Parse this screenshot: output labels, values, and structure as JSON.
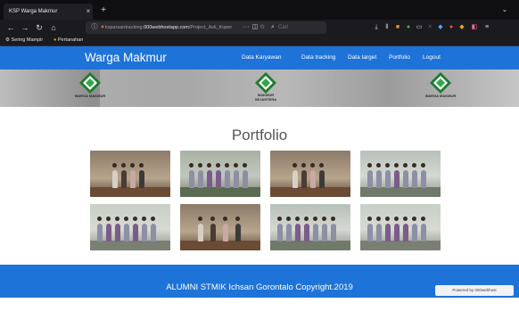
{
  "browser": {
    "tab_title": "KSP Warga Makmur",
    "tab_close": "×",
    "new_tab": "+",
    "url_prefix": "ksparsantracking.",
    "url_domain": "000webhostapp.com",
    "url_path": "/Project_Asli_Koper",
    "search_placeholder": "Cari",
    "bookmarks": [
      "Sering Mampir",
      "Pertanahan"
    ]
  },
  "site": {
    "brand": "Warga Makmur",
    "nav": [
      "Data Karyawan",
      "Data tracking",
      "Data target",
      "Portfolio",
      "Logout"
    ]
  },
  "banner": {
    "logos": [
      "WARGA MAKMUR",
      "MAKMUR SEJAHTERA",
      "WARGA MAKMUR"
    ]
  },
  "portfolio": {
    "title": "Portfolio"
  },
  "footer": {
    "text": "ALUMNI STMIK Ichsan Gorontalo Copyright.2019",
    "badge": "Powered by 000webhost"
  },
  "colors": {
    "primary": "#1e73d8",
    "chrome_dark": "#1b1b1f"
  }
}
